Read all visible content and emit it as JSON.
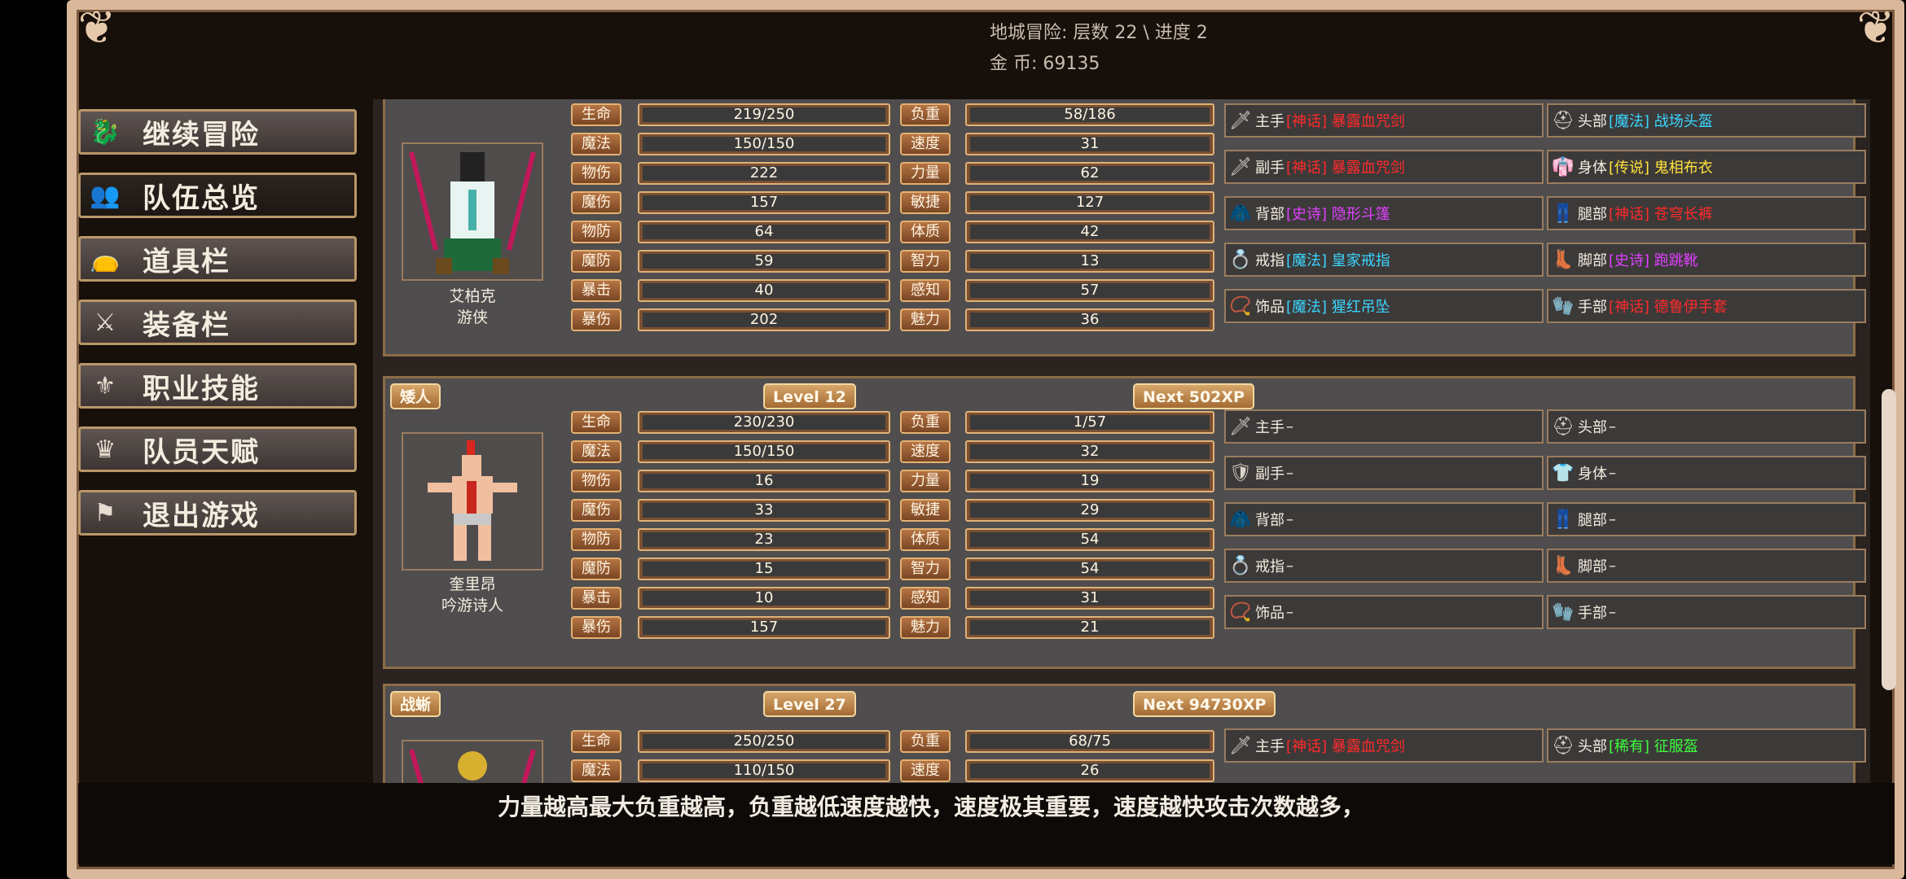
{
  "header": {
    "dungeon_label": "地城冒险: 层数 22 \\ 进度 2",
    "gold_label": "金    币: 69135"
  },
  "menu": [
    {
      "label": "继续冒险",
      "icon": "dragon-icon"
    },
    {
      "label": "队伍总览",
      "icon": "party-icon"
    },
    {
      "label": "道具栏",
      "icon": "bag-icon"
    },
    {
      "label": "装备栏",
      "icon": "weapons-icon"
    },
    {
      "label": "职业技能",
      "icon": "wings-icon"
    },
    {
      "label": "队员天赋",
      "icon": "laurel-icon"
    },
    {
      "label": "退出游戏",
      "icon": "flag-icon"
    }
  ],
  "stat_labels": {
    "left": [
      "生命",
      "魔法",
      "物伤",
      "魔伤",
      "物防",
      "魔防",
      "暴击",
      "暴伤"
    ],
    "right": [
      "负重",
      "速度",
      "力量",
      "敏捷",
      "体质",
      "智力",
      "感知",
      "魅力"
    ]
  },
  "characters": [
    {
      "name": "艾柏克",
      "class": "游侠",
      "left_values": [
        "219/250",
        "150/150",
        "222",
        "157",
        "64",
        "59",
        "40",
        "202"
      ],
      "right_values": [
        "58/186",
        "31",
        "62",
        "127",
        "42",
        "13",
        "57",
        "36"
      ],
      "equipment": [
        {
          "slot": "主手",
          "rarity": "[神话] 暴露血咒剑",
          "color": "#ff2a2a",
          "icon": "sword-icon"
        },
        {
          "slot": "头部",
          "rarity": "[魔法] 战场头盔",
          "color": "#3ad6ff",
          "icon": "helmet-icon"
        },
        {
          "slot": "副手",
          "rarity": "[神话] 暴露血咒剑",
          "color": "#ff2a2a",
          "icon": "sword-icon"
        },
        {
          "slot": "身体",
          "rarity": "[传说] 鬼相布衣",
          "color": "#ffe23a",
          "icon": "robe-icon"
        },
        {
          "slot": "背部",
          "rarity": "[史诗] 隐形斗篷",
          "color": "#e040ff",
          "icon": "cape-icon"
        },
        {
          "slot": "腿部",
          "rarity": "[神话] 苍穹长裤",
          "color": "#ff2a2a",
          "icon": "pants-icon"
        },
        {
          "slot": "戒指",
          "rarity": "[魔法] 皇家戒指",
          "color": "#3ad6ff",
          "icon": "ring-icon"
        },
        {
          "slot": "脚部",
          "rarity": "[史诗] 跑跳靴",
          "color": "#e040ff",
          "icon": "boots-icon"
        },
        {
          "slot": "饰品",
          "rarity": "[魔法] 猩红吊坠",
          "color": "#3ad6ff",
          "icon": "amulet-icon"
        },
        {
          "slot": "手部",
          "rarity": "[神话] 德鲁伊手套",
          "color": "#ff2a2a",
          "icon": "gloves-icon"
        }
      ]
    },
    {
      "race": "矮人",
      "level": "Level 12",
      "next": "Next 502XP",
      "name": "奎里昂",
      "class": "吟游诗人",
      "left_values": [
        "230/230",
        "150/150",
        "16",
        "33",
        "23",
        "15",
        "10",
        "157"
      ],
      "right_values": [
        "1/57",
        "32",
        "19",
        "29",
        "54",
        "54",
        "31",
        "21"
      ],
      "equipment": [
        {
          "slot": "主手",
          "rarity": "–",
          "color": "#f3ecdf",
          "icon": "sword-icon"
        },
        {
          "slot": "头部",
          "rarity": "–",
          "color": "#f3ecdf",
          "icon": "helmet-icon"
        },
        {
          "slot": "副手",
          "rarity": "–",
          "color": "#f3ecdf",
          "icon": "shield-icon"
        },
        {
          "slot": "身体",
          "rarity": "–",
          "color": "#f3ecdf",
          "icon": "shirt-icon"
        },
        {
          "slot": "背部",
          "rarity": "–",
          "color": "#f3ecdf",
          "icon": "cape-icon"
        },
        {
          "slot": "腿部",
          "rarity": "–",
          "color": "#f3ecdf",
          "icon": "pants-icon"
        },
        {
          "slot": "戒指",
          "rarity": "–",
          "color": "#f3ecdf",
          "icon": "ring-icon"
        },
        {
          "slot": "脚部",
          "rarity": "–",
          "color": "#f3ecdf",
          "icon": "boots-icon"
        },
        {
          "slot": "饰品",
          "rarity": "–",
          "color": "#f3ecdf",
          "icon": "amulet-icon"
        },
        {
          "slot": "手部",
          "rarity": "–",
          "color": "#f3ecdf",
          "icon": "gloves-icon"
        }
      ]
    },
    {
      "race": "战蜥",
      "level": "Level 27",
      "next": "Next 94730XP",
      "left_values": [
        "250/250",
        "110/150"
      ],
      "right_values": [
        "68/75",
        "26"
      ],
      "equipment": [
        {
          "slot": "主手",
          "rarity": "[神话] 暴露血咒剑",
          "color": "#ff2a2a",
          "icon": "sword-icon"
        },
        {
          "slot": "头部",
          "rarity": "[稀有] 征服盔",
          "color": "#3cff3c",
          "icon": "helmet-icon"
        }
      ]
    }
  ],
  "hint": "力量越高最大负重越高，负重越低速度越快，速度极其重要，速度越快攻击次数越多，"
}
